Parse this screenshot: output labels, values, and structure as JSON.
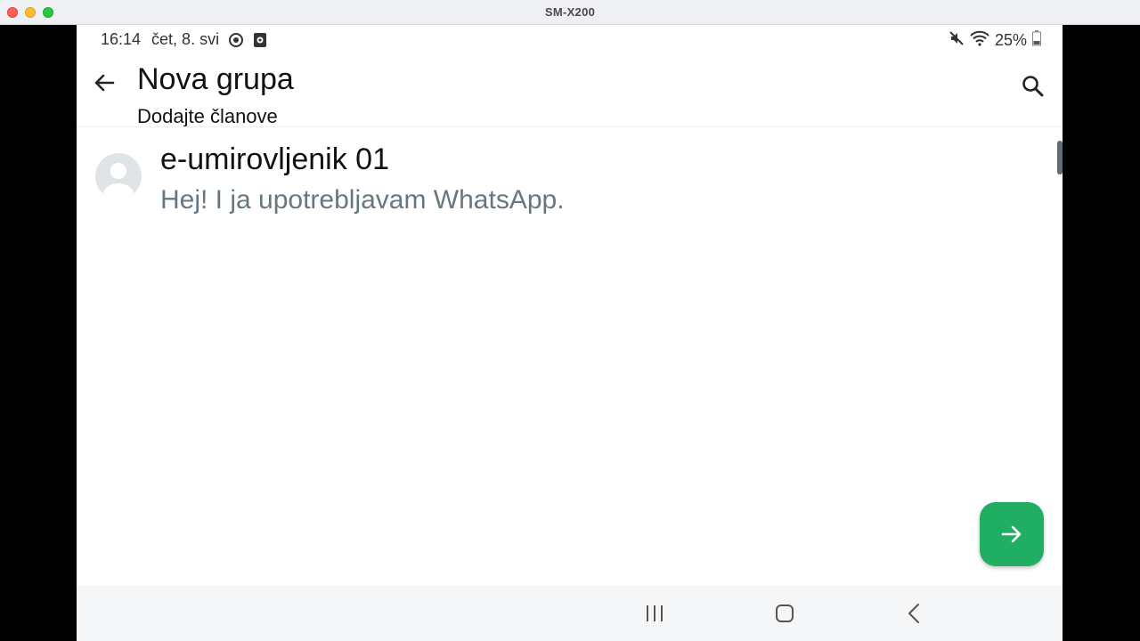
{
  "window": {
    "title": "SM-X200"
  },
  "status_bar": {
    "time": "16:14",
    "date": "čet, 8. svi",
    "battery": "25%",
    "icons": [
      "sync-icon",
      "media-icon",
      "mute-icon",
      "wifi-icon",
      "battery-icon"
    ]
  },
  "app_bar": {
    "title": "Nova grupa",
    "subtitle": "Dodajte članove",
    "icons": [
      "back-arrow-icon",
      "search-icon"
    ]
  },
  "contacts": [
    {
      "name": "e-umirovljenik 01",
      "status": "Hej! I ja upotrebljavam WhatsApp."
    }
  ],
  "fab": {
    "icon": "arrow-right-icon",
    "color": "#1fae62"
  },
  "nav_bar": {
    "icons": [
      "recents-icon",
      "home-icon",
      "back-icon"
    ]
  }
}
